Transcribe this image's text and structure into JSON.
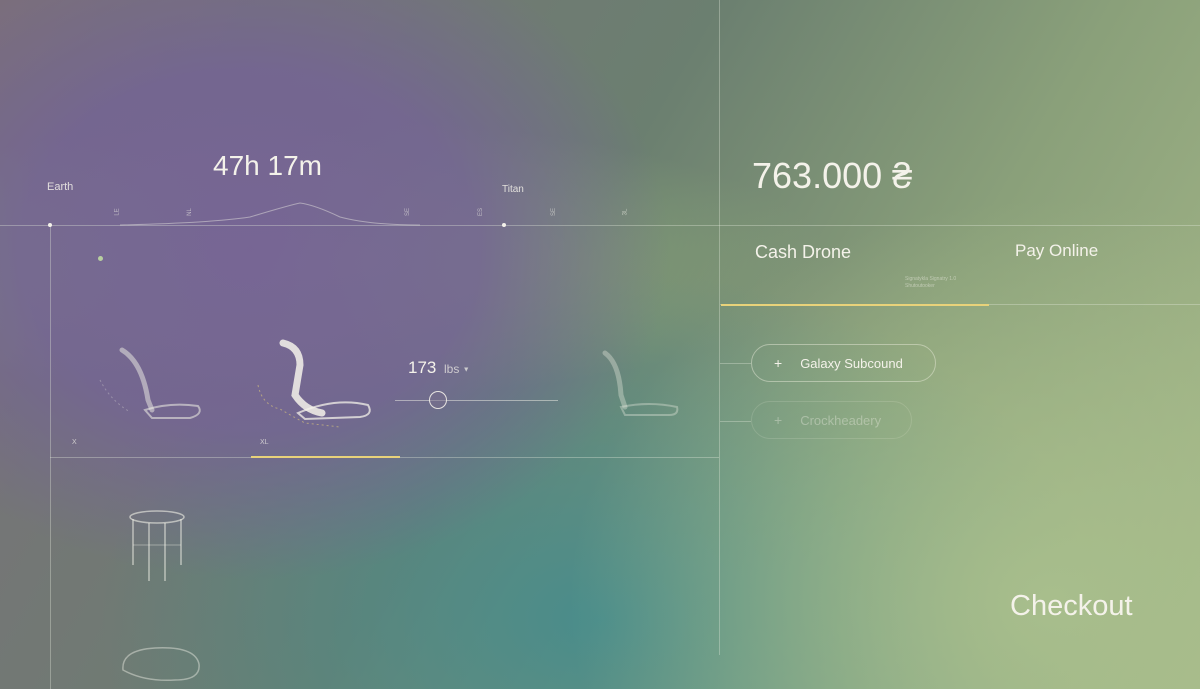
{
  "trip": {
    "duration": "47h 17m",
    "origin": "Earth",
    "destination": "Titan",
    "ticks": [
      "LE",
      "NL",
      "SE",
      "ES",
      "SE",
      "3L"
    ]
  },
  "seats": {
    "size_labels": [
      "X",
      "XL"
    ],
    "weight_value": "173",
    "weight_unit": "lbs",
    "weight_dropdown_icon": "caret-down-icon"
  },
  "price": {
    "amount": "763.000 ₴"
  },
  "payment": {
    "tabs": [
      {
        "label": "Cash Drone",
        "active": true
      },
      {
        "label": "Pay Online",
        "active": false
      }
    ],
    "fine_print": "Signatykla Signatry 1.0 Shutoutooker"
  },
  "options": [
    {
      "icon": "plus-icon",
      "label": "Galaxy Subcound",
      "enabled": true
    },
    {
      "icon": "plus-icon",
      "label": "Crockheadery",
      "enabled": false
    }
  ],
  "checkout_label": "Checkout",
  "colors": {
    "accent": "#e8d27a",
    "text": "#f4f2ea"
  }
}
